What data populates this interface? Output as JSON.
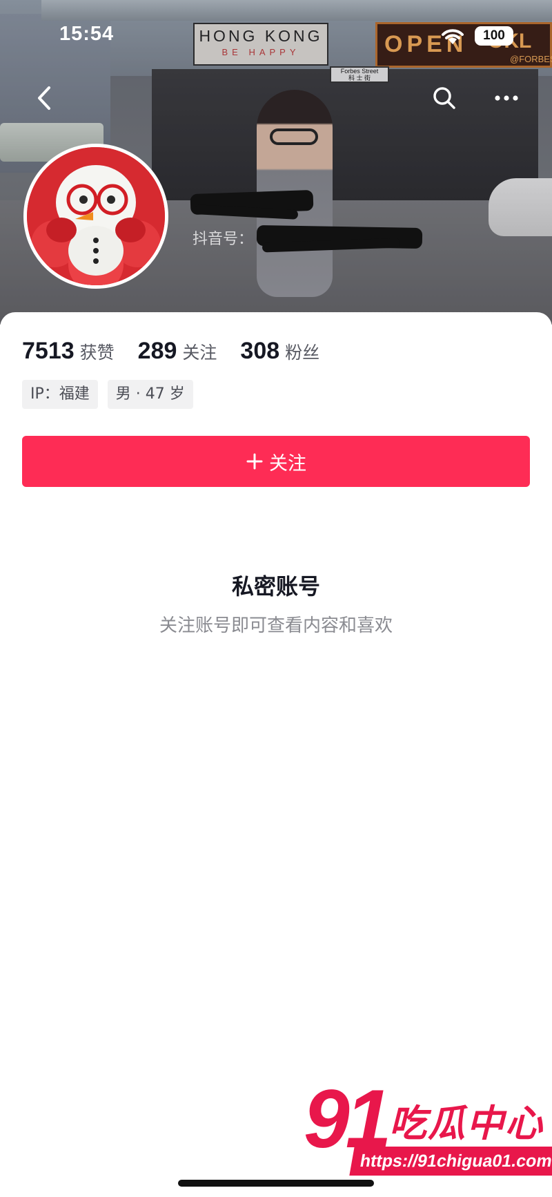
{
  "status_bar": {
    "time": "15:54",
    "battery": "100",
    "wifi_icon": "wifi-icon"
  },
  "cover": {
    "sign_hong_kong": "HONG KONG",
    "sign_be_happy": "BE HAPPY",
    "sign_open": "OPEN",
    "sign_okl": "OKL",
    "sign_forbes": "@FORBES",
    "street_sign_en": "Forbes Street",
    "street_sign_zh": "科 士 街"
  },
  "nav": {
    "back_icon": "chevron-left-icon",
    "search_icon": "search-icon",
    "more_icon": "more-horizontal-icon"
  },
  "profile": {
    "douyin_id_label": "抖音号：",
    "likes_count": "7513",
    "likes_label": "获赞",
    "following_count": "289",
    "following_label": "关注",
    "followers_count": "308",
    "followers_label": "粉丝",
    "ip_tag": "IP：福建",
    "gender_age_tag": "男 · 47 岁"
  },
  "follow_button": {
    "icon": "plus-icon",
    "label": "关注"
  },
  "private_notice": {
    "title": "私密账号",
    "description": "关注账号即可查看内容和喜欢"
  },
  "watermark": {
    "number": "91",
    "name": "吃瓜中心",
    "url": "https://91chigua01.com"
  },
  "colors": {
    "accent": "#fe2c55",
    "watermark": "#e8174b",
    "text_primary": "#161823",
    "text_secondary": "#8a8b91"
  }
}
